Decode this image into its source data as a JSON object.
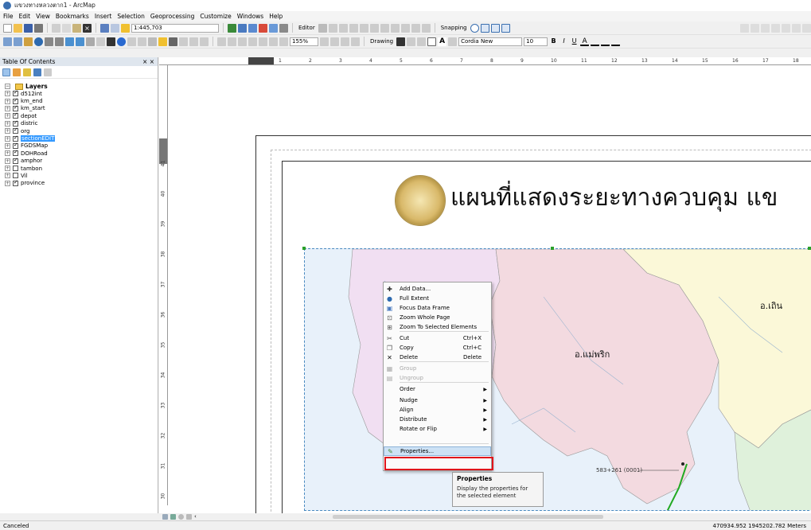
{
  "window": {
    "title": "แขวงทางหลวงตาก1 - ArcMap"
  },
  "menu": [
    "File",
    "Edit",
    "View",
    "Bookmarks",
    "Insert",
    "Selection",
    "Geoprocessing",
    "Customize",
    "Windows",
    "Help"
  ],
  "toolbar": {
    "scale": "1:445,703",
    "editor_label": "Editor",
    "drawing_label": "Drawing",
    "snapping_label": "Snapping",
    "zoom_percent": "155%",
    "font_name": "Cordia New",
    "font_size": "10"
  },
  "toc": {
    "title": "Table Of Contents",
    "close_label": "× ×",
    "root": "Layers",
    "layers": [
      {
        "name": "d512int",
        "checked": true,
        "selected": false
      },
      {
        "name": "km_end",
        "checked": true,
        "selected": false
      },
      {
        "name": "km_start",
        "checked": true,
        "selected": false
      },
      {
        "name": "depot",
        "checked": true,
        "selected": false
      },
      {
        "name": "distric",
        "checked": true,
        "selected": false
      },
      {
        "name": "org",
        "checked": true,
        "selected": false
      },
      {
        "name": "sectionEDIT",
        "checked": true,
        "selected": true
      },
      {
        "name": "FGDSMap",
        "checked": true,
        "selected": false
      },
      {
        "name": "DOHRoad",
        "checked": true,
        "selected": false
      },
      {
        "name": "amphor",
        "checked": true,
        "selected": false
      },
      {
        "name": "tambon",
        "checked": false,
        "selected": false
      },
      {
        "name": "Vil",
        "checked": false,
        "selected": false
      },
      {
        "name": "province",
        "checked": true,
        "selected": false
      }
    ]
  },
  "rulers": {
    "top": [
      "1",
      "2",
      "3",
      "4",
      "5",
      "6",
      "7",
      "8",
      "9",
      "10",
      "11",
      "12",
      "13",
      "14",
      "15",
      "16",
      "17",
      "18"
    ],
    "left": [
      "41",
      "40",
      "39",
      "38",
      "37",
      "36",
      "35",
      "34",
      "33",
      "32",
      "31",
      "30"
    ]
  },
  "map": {
    "title": "แผนที่แสดงระยะทางควบคุม แข",
    "labels": {
      "district_1": "อ.เถิน",
      "district_2": "อ.แม่พริก"
    },
    "km_marker": "583+261 (0001)"
  },
  "context_menu": {
    "items": [
      {
        "label": "Add Data...",
        "shortcut": "",
        "submenu": false,
        "disabled": false,
        "icon": "add-data-icon"
      },
      {
        "label": "Full Extent",
        "shortcut": "",
        "submenu": false,
        "disabled": false,
        "icon": "globe-icon"
      },
      {
        "label": "Focus Data Frame",
        "shortcut": "",
        "submenu": false,
        "disabled": false,
        "icon": "focus-icon"
      },
      {
        "label": "Zoom Whole Page",
        "shortcut": "",
        "submenu": false,
        "disabled": false,
        "icon": "zoom-page-icon"
      },
      {
        "label": "Zoom To Selected Elements",
        "shortcut": "",
        "submenu": false,
        "disabled": false,
        "icon": "zoom-selected-icon"
      },
      {
        "label": "Cut",
        "shortcut": "Ctrl+X",
        "submenu": false,
        "disabled": false,
        "icon": "cut-icon"
      },
      {
        "label": "Copy",
        "shortcut": "Ctrl+C",
        "submenu": false,
        "disabled": false,
        "icon": "copy-icon"
      },
      {
        "label": "Delete",
        "shortcut": "Delete",
        "submenu": false,
        "disabled": false,
        "icon": "delete-icon"
      },
      {
        "label": "Group",
        "shortcut": "",
        "submenu": false,
        "disabled": true,
        "icon": "group-icon"
      },
      {
        "label": "Ungroup",
        "shortcut": "",
        "submenu": false,
        "disabled": true,
        "icon": "ungroup-icon"
      },
      {
        "label": "Order",
        "shortcut": "",
        "submenu": true,
        "disabled": false,
        "icon": ""
      },
      {
        "label": "Nudge",
        "shortcut": "",
        "submenu": true,
        "disabled": false,
        "icon": ""
      },
      {
        "label": "Align",
        "shortcut": "",
        "submenu": true,
        "disabled": false,
        "icon": ""
      },
      {
        "label": "Distribute",
        "shortcut": "",
        "submenu": true,
        "disabled": false,
        "icon": ""
      },
      {
        "label": "Rotate or Flip",
        "shortcut": "",
        "submenu": true,
        "disabled": false,
        "icon": ""
      },
      {
        "label": "Properties...",
        "shortcut": "",
        "submenu": false,
        "disabled": false,
        "icon": "properties-icon"
      }
    ]
  },
  "tooltip": {
    "title": "Properties",
    "body": "Display the properties for the selected element"
  },
  "status": {
    "left": "Canceled",
    "coordinates": "470934.952  1945202.782 Meters"
  },
  "colors": {
    "highlight_outline": "#e0151b",
    "selected_layer": "#3399ff",
    "road_green": "#22aa22",
    "zone_pink": "#f3dae0",
    "zone_purple": "#f1dff2",
    "zone_yellow": "#fbf8d8",
    "zone_green": "#dff1db"
  }
}
